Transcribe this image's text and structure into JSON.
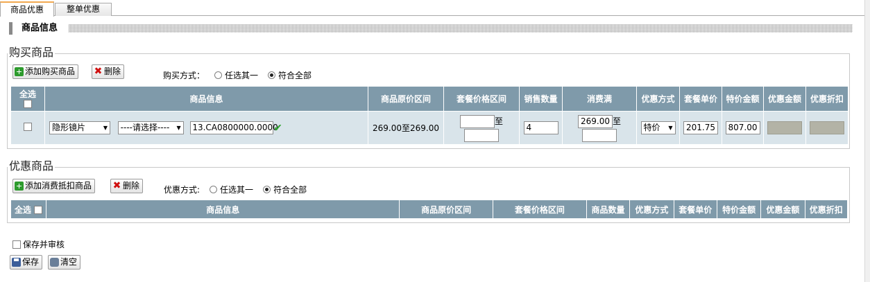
{
  "tabs": [
    {
      "label": "商品优惠"
    },
    {
      "label": "整单优惠"
    }
  ],
  "section": {
    "title": "商品信息"
  },
  "buy": {
    "legend": "购买商品",
    "add_button": "添加购买商品",
    "delete_button": "删除",
    "mode_label": "购买方式：",
    "options": [
      "任选其一",
      "符合全部"
    ],
    "selected": "符合全部",
    "select_all": "全选",
    "headers": [
      "商品信息",
      "商品原价区间",
      "套餐价格区间",
      "销售数量",
      "消费满",
      "优惠方式",
      "套餐单价",
      "特价金额",
      "优惠金额",
      "优惠折扣"
    ],
    "row": {
      "category": "隐形镜片",
      "sub_select": "----请选择----",
      "code": "13.CA0800000.0000",
      "price_range": "269.00至269.00",
      "range_sep": "至",
      "range_from": "",
      "range_to": "",
      "quantity": "4",
      "spend_full": "269.00",
      "spend_sep": "至",
      "spend_to": "",
      "discount_type": "特价",
      "unit_price": "201.75",
      "special_amount": "807.00"
    }
  },
  "promo": {
    "legend": "优惠商品",
    "add_button": "添加消费抵扣商品",
    "delete_button": "删除",
    "mode_label": "优惠方式:",
    "options": [
      "任选其一",
      "符合全部"
    ],
    "selected": "符合全部",
    "select_all": "全选",
    "headers": [
      "商品信息",
      "商品原价区间",
      "套餐价格区间",
      "商品数量",
      "优惠方式",
      "套餐单价",
      "特价金额",
      "优惠金额",
      "优惠折扣"
    ]
  },
  "footer": {
    "save_audit": "保存并审核",
    "save_button": "保存",
    "clear_button": "清空"
  },
  "colors": {
    "header_bg": "#7f9aaa",
    "row_bg": "#d9e4ea",
    "tab_accent": "#f2a84f"
  }
}
